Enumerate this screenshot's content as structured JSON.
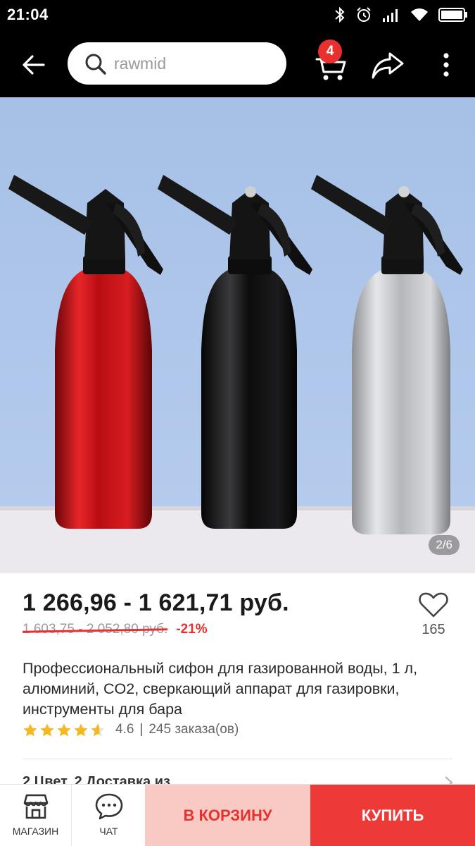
{
  "status_bar": {
    "time": "21:04",
    "icons": [
      "bluetooth-icon",
      "alarm-icon",
      "signal-icon",
      "wifi-icon",
      "battery-icon"
    ]
  },
  "toolbar": {
    "search_placeholder": "rawmid",
    "cart_badge": "4"
  },
  "gallery": {
    "counter": "2/6",
    "current": 2,
    "total": 6
  },
  "product": {
    "price_range": "1 266,96 - 1 621,71 руб.",
    "old_price_range": "1 603,75 - 2 052,80 руб.",
    "discount": "-21%",
    "wishlist_count": "165",
    "title": "Профессиональный сифон для газированной воды, 1 л, алюминий, CO2, сверкающий аппарат для газировки, инструменты для бара",
    "rating_value": "4.6",
    "rating": 4.6,
    "rating_max": 5,
    "orders": "245 заказа(ов)",
    "partial_row": "2 Цвет, 2 Доставка из"
  },
  "bottom_bar": {
    "store_label": "МАГАЗИН",
    "chat_label": "ЧАТ",
    "add_to_cart_label": "В КОРЗИНУ",
    "buy_label": "КУПИТЬ"
  },
  "colors": {
    "accent_red": "#e8312e",
    "buy_button": "#ee3a37",
    "cart_button_bg": "#f9c9c3",
    "star": "#f6b820",
    "toolbar_bg": "#000000"
  }
}
